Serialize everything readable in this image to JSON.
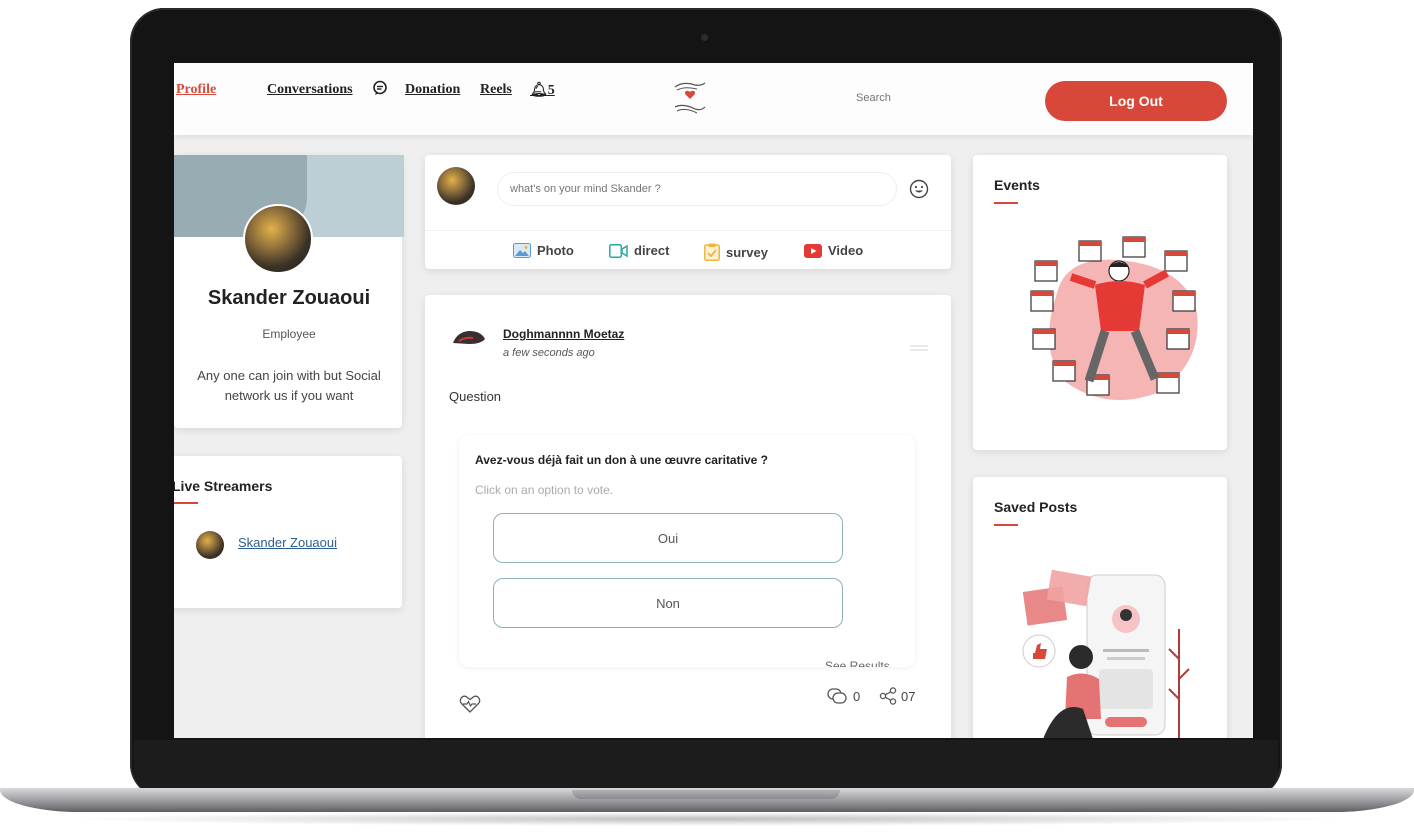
{
  "nav": {
    "profile": "Profile",
    "conversations": "Conversations",
    "donation": "Donation",
    "reels": "Reels",
    "notification_count": "5",
    "search_placeholder": "Search",
    "logout": "Log Out"
  },
  "profile_card": {
    "name": "Skander Zouaoui",
    "role": "Employee",
    "bio": "Any one can join with but Social network us if you want"
  },
  "live_streamers": {
    "title": "Live Streamers",
    "items": [
      {
        "name": "Skander Zouaoui"
      }
    ]
  },
  "composer": {
    "placeholder": "what's on your mind Skander ?",
    "actions": [
      {
        "label": "Photo",
        "icon": "photo-icon",
        "color": "#5b9bd5"
      },
      {
        "label": "direct",
        "icon": "video-camera-icon",
        "color": "#27a9a0"
      },
      {
        "label": "survey",
        "icon": "clipboard-check-icon",
        "color": "#f1b43a"
      },
      {
        "label": "Video",
        "icon": "youtube-play-icon",
        "color": "#e53935"
      }
    ]
  },
  "post": {
    "author": "Doghmannnn Moetaz",
    "time": "a few seconds ago",
    "text": "Question",
    "poll": {
      "question": "Avez-vous déjà fait un don à une œuvre caritative ?",
      "hint": "Click on an option to vote.",
      "options": [
        "Oui",
        "Non"
      ],
      "see_results": "See Results"
    },
    "comments": "0",
    "shares": "07"
  },
  "right": {
    "events_title": "Events",
    "saved_title": "Saved Posts"
  },
  "colors": {
    "accent": "#d8483a",
    "poll_border": "#8fb2b8"
  }
}
